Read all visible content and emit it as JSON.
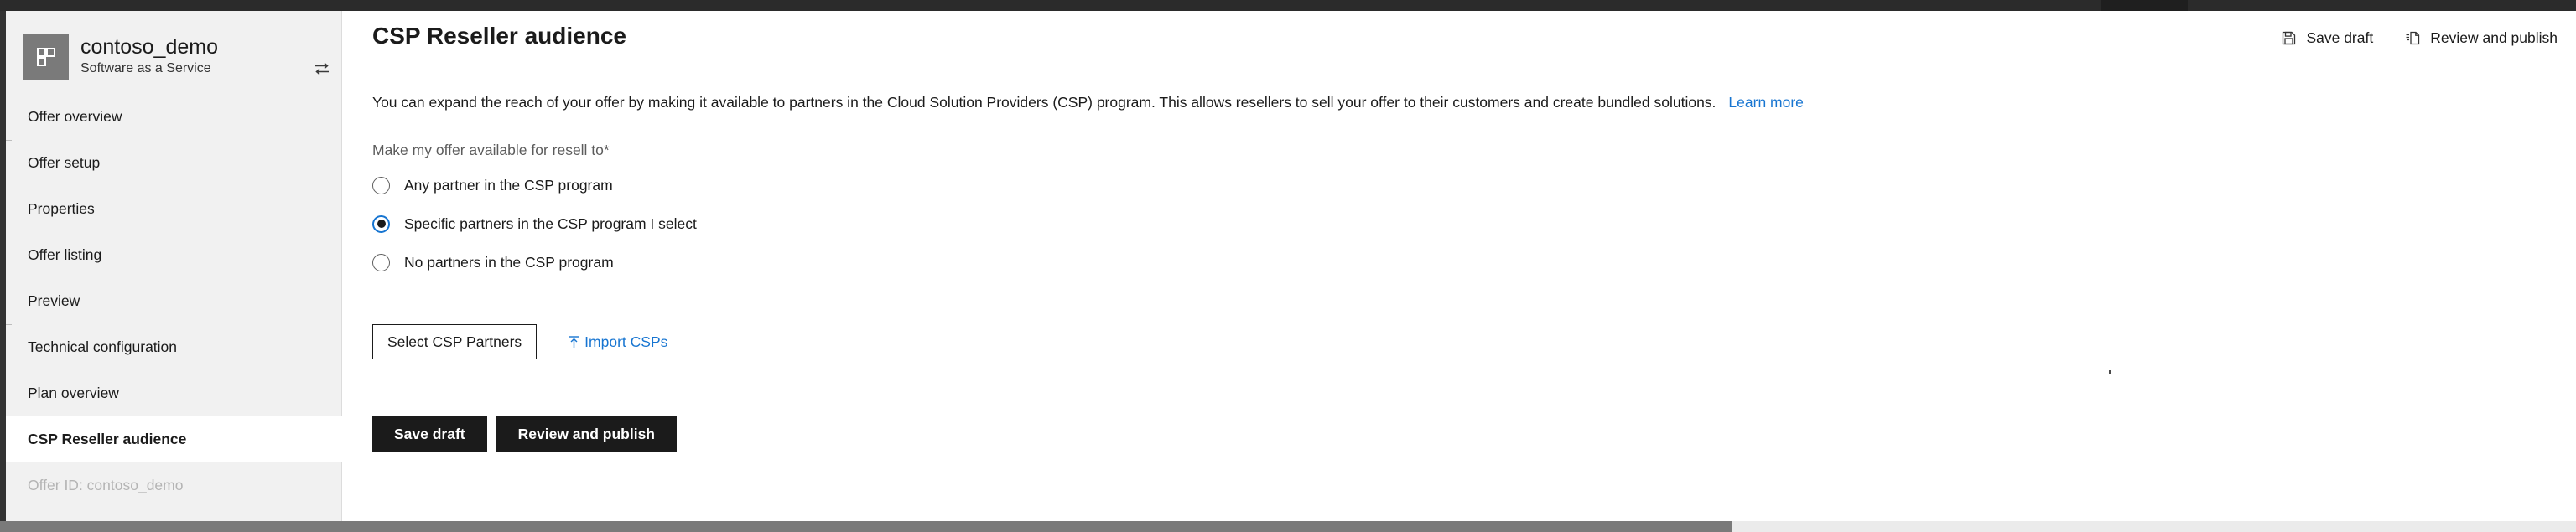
{
  "window": {
    "chrome_color": "#2b2b2b",
    "accent_color": "#1775d1"
  },
  "sidebar": {
    "offer": {
      "name": "contoso_demo",
      "type": "Software as a Service",
      "logo_icon": "grid-squares-icon",
      "swap_icon": "swap-offer-icon"
    },
    "items": [
      {
        "label": "Offer overview",
        "selected": false,
        "divider_above": false
      },
      {
        "label": "Offer setup",
        "selected": false,
        "divider_above": true
      },
      {
        "label": "Properties",
        "selected": false,
        "divider_above": false
      },
      {
        "label": "Offer listing",
        "selected": false,
        "divider_above": false
      },
      {
        "label": "Preview",
        "selected": false,
        "divider_above": false
      },
      {
        "label": "Technical configuration",
        "selected": false,
        "divider_above": true
      },
      {
        "label": "Plan overview",
        "selected": false,
        "divider_above": false
      },
      {
        "label": "CSP Reseller audience",
        "selected": true,
        "divider_above": false
      }
    ],
    "offer_id_label": "Offer ID: contoso_demo"
  },
  "header": {
    "title": "CSP Reseller audience",
    "actions": [
      {
        "label": "Save draft",
        "icon": "save-icon"
      },
      {
        "label": "Review and publish",
        "icon": "review-publish-icon"
      }
    ]
  },
  "main": {
    "description": "You can expand the reach of your offer by making it available to partners in the Cloud Solution Providers (CSP) program. This allows resellers to sell your offer to their customers and create bundled solutions.",
    "learn_more_label": "Learn more",
    "field_label": "Make my offer available for resell to*",
    "radio_options": [
      {
        "label": "Any partner in the CSP program",
        "checked": false
      },
      {
        "label": "Specific partners in the CSP program I select",
        "checked": true
      },
      {
        "label": "No partners in the CSP program",
        "checked": false
      }
    ],
    "select_partners_label": "Select CSP Partners",
    "import_csps_label": "Import CSPs",
    "import_icon": "upload-icon",
    "footer_buttons": [
      {
        "label": "Save draft"
      },
      {
        "label": "Review and publish"
      }
    ]
  }
}
